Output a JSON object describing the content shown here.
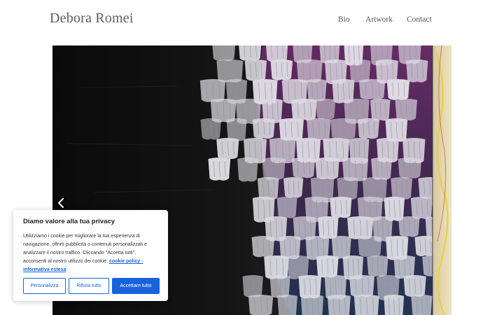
{
  "header": {
    "site_title": "Debora Romei",
    "nav": [
      {
        "label": "Bio"
      },
      {
        "label": "Artwork"
      },
      {
        "label": "Contact"
      }
    ]
  },
  "slider": {
    "prev_icon": "chevron-left-icon",
    "artwork_colors": [
      "#0d0d0d",
      "#e9e9ee",
      "#6b2a6b",
      "#2d4a6e",
      "#e6d13a"
    ]
  },
  "cookie_banner": {
    "title": "Diamo valore alla tua privacy",
    "text": "Utilizziamo i cookie per migliorare la tua esperienza di navigazione, offrirti pubblicità o contenuti personalizzati e analizzare il nostro traffico. Cliccando \"Accetta tutti\", acconsenti al nostro utilizzo dei cookie.",
    "link": "cookie policy - informativa estesa",
    "buttons": {
      "customize": "Personalizza",
      "reject": "Rifiuta tutto",
      "accept": "Accettare tutto"
    },
    "accent_color": "#1863dc"
  }
}
